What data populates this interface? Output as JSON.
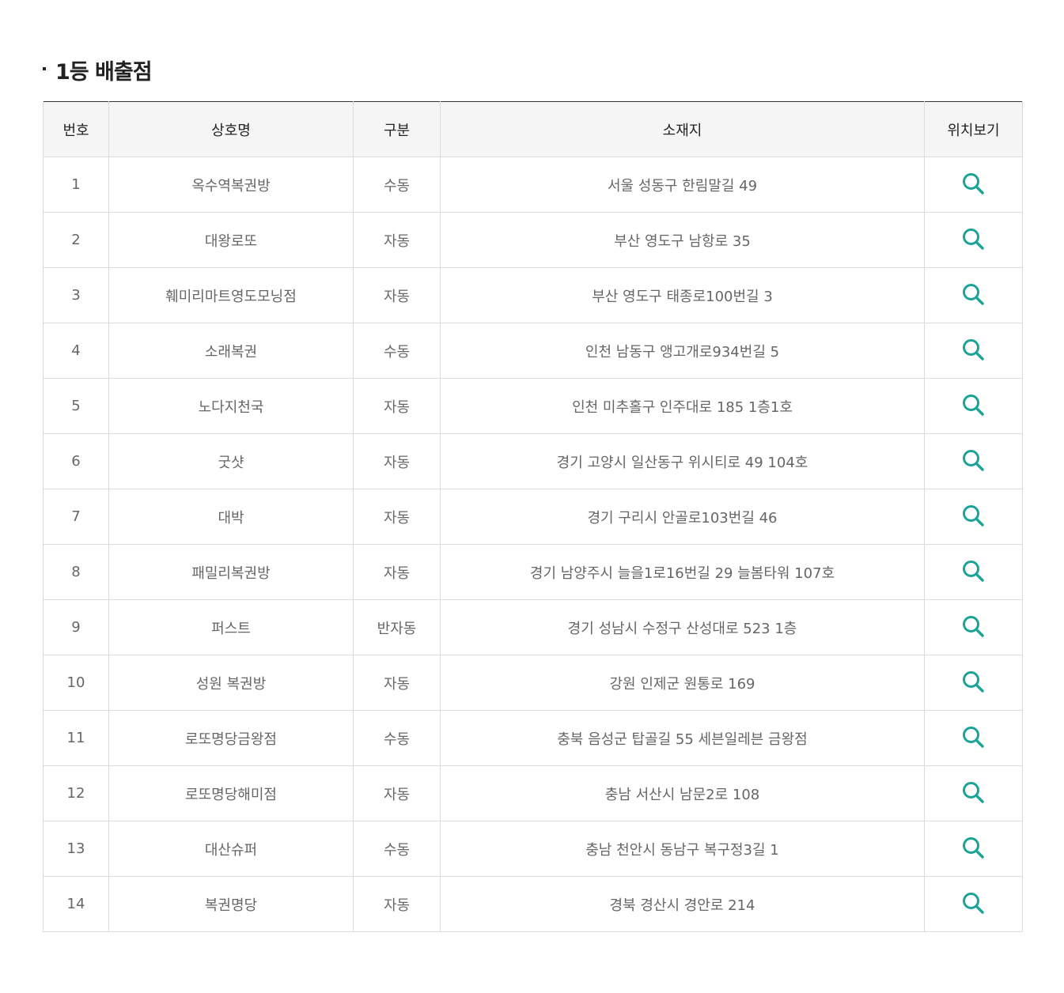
{
  "section": {
    "title": "1등 배출점"
  },
  "table": {
    "headers": [
      "번호",
      "상호명",
      "구분",
      "소재지",
      "위치보기"
    ],
    "rows": [
      {
        "no": "1",
        "name": "옥수역복권방",
        "type": "수동",
        "address": "서울 성동구 한림말길 49"
      },
      {
        "no": "2",
        "name": "대왕로또",
        "type": "자동",
        "address": "부산 영도구 남항로 35"
      },
      {
        "no": "3",
        "name": "훼미리마트영도모닝점",
        "type": "자동",
        "address": "부산 영도구 태종로100번길 3"
      },
      {
        "no": "4",
        "name": "소래복권",
        "type": "수동",
        "address": "인천 남동구 앵고개로934번길 5"
      },
      {
        "no": "5",
        "name": "노다지천국",
        "type": "자동",
        "address": "인천 미추홀구 인주대로 185 1층1호"
      },
      {
        "no": "6",
        "name": "굿샷",
        "type": "자동",
        "address": "경기 고양시 일산동구 위시티로 49 104호"
      },
      {
        "no": "7",
        "name": "대박",
        "type": "자동",
        "address": "경기 구리시 안골로103번길 46"
      },
      {
        "no": "8",
        "name": "패밀리복권방",
        "type": "자동",
        "address": "경기 남양주시 늘을1로16번길 29 늘봄타워 107호"
      },
      {
        "no": "9",
        "name": "퍼스트",
        "type": "반자동",
        "address": "경기 성남시 수정구 산성대로 523 1층"
      },
      {
        "no": "10",
        "name": "성원 복권방",
        "type": "자동",
        "address": "강원 인제군 원통로 169"
      },
      {
        "no": "11",
        "name": "로또명당금왕점",
        "type": "수동",
        "address": "충북 음성군 탑골길 55 세븐일레븐 금왕점"
      },
      {
        "no": "12",
        "name": "로또명당해미점",
        "type": "자동",
        "address": "충남 서산시 남문2로 108"
      },
      {
        "no": "13",
        "name": "대산슈퍼",
        "type": "수동",
        "address": "충남 천안시 동남구 복구정3길 1"
      },
      {
        "no": "14",
        "name": "복권명당",
        "type": "자동",
        "address": "경북 경산시 경안로 214"
      }
    ],
    "location_icon": "search-icon",
    "icon_color": "#1aa396"
  }
}
